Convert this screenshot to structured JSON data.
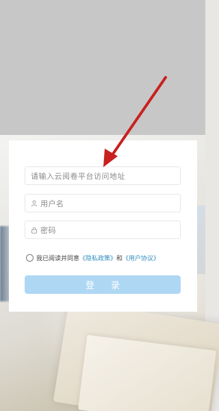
{
  "form": {
    "url_placeholder": "请输入云阅卷平台访问地址",
    "username_placeholder": "用户名",
    "password_placeholder": "密码",
    "agree_prefix": "我已阅读并同意",
    "privacy_link": "《隐私政策》",
    "agree_and": "和",
    "user_agreement_link": "《用户协议》",
    "login_label": "登 录"
  },
  "icons": {
    "user": "user-icon",
    "lock": "lock-icon",
    "annotation": "red-arrow-icon"
  },
  "colors": {
    "login_button": "#aed7f4",
    "link": "#2f8bbf",
    "annotation_arrow": "#c8211f"
  }
}
